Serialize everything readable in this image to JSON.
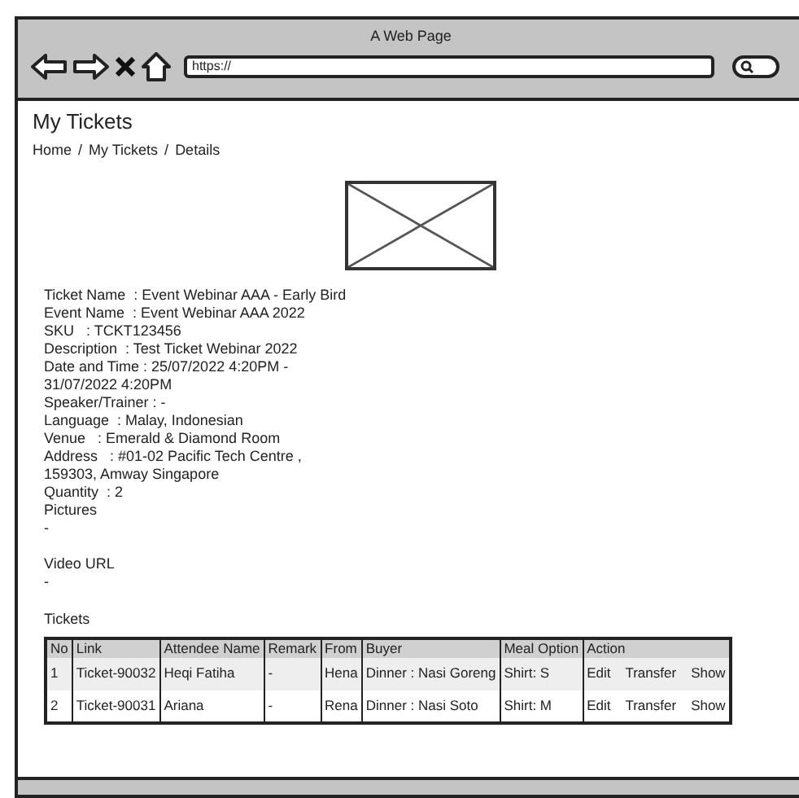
{
  "window": {
    "title": "A Web Page",
    "address": "https://"
  },
  "page": {
    "title": "My Tickets",
    "breadcrumb": [
      "Home",
      "/",
      "My Tickets",
      "/",
      "Details"
    ]
  },
  "details": [
    "Ticket Name  : Event Webinar AAA - Early Bird",
    "Event Name  : Event Webinar AAA 2022",
    "SKU   : TCKT123456",
    "Description  : Test Ticket Webinar 2022",
    "Date and Time : 25/07/2022 4:20PM -",
    "31/07/2022 4:20PM",
    "Speaker/Trainer : -",
    "Language  : Malay, Indonesian",
    "Venue   : Emerald & Diamond Room",
    "Address   : #01-02 Pacific Tech Centre ,",
    "159303, Amway Singapore",
    "Quantity  : 2"
  ],
  "pictures": {
    "label": "Pictures",
    "value": "-"
  },
  "video_url": {
    "label": "Video URL",
    "value": "-"
  },
  "tickets": {
    "title": "Tickets",
    "columns": [
      "No",
      "Link",
      "Attendee Name",
      "Remark",
      "From",
      "Buyer",
      "Meal Option",
      "Action"
    ],
    "rows": [
      {
        "cells": [
          "1",
          "Ticket-90032",
          "Heqi Fatiha",
          "-",
          "Hena",
          "Dinner : Nasi Goreng",
          "Shirt: S"
        ],
        "actions": [
          "Edit",
          "Transfer",
          "Show"
        ]
      },
      {
        "cells": [
          "2",
          "Ticket-90031",
          "Ariana",
          "-",
          "Rena",
          "Dinner : Nasi Soto",
          "Shirt: M"
        ],
        "actions": [
          "Edit",
          "Transfer",
          "Show"
        ]
      }
    ]
  }
}
